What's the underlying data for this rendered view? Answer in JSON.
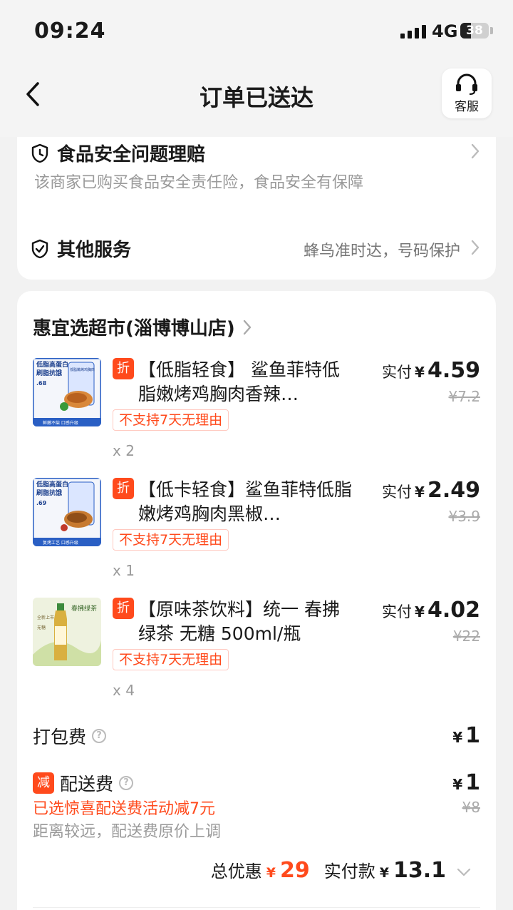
{
  "status_bar": {
    "time": "09:24",
    "network": "4G",
    "battery": "38",
    "battery_level": 0.38
  },
  "nav": {
    "title": "订单已送达",
    "service_label": "客服"
  },
  "services": {
    "food_safety": {
      "title": "食品安全问题理赔",
      "desc": "该商家已购买食品安全责任险，食品安全有保障"
    },
    "other": {
      "title": "其他服务",
      "value": "蜂鸟准时达，号码保护"
    }
  },
  "store": {
    "name": "惠宜选超市(淄博博山店)"
  },
  "items": [
    {
      "badge": "折",
      "name": "【低脂轻食】 鲨鱼菲特低脂嫩烤鸡胸肉香辣…",
      "tag": "不支持7天无理由",
      "qty": "x 2",
      "price_label": "实付",
      "currency": "¥",
      "price": "4.59",
      "orig_price": "¥7.2",
      "thumb": {
        "line1": "低脂高蛋白",
        "line2": "刷脂抗饿",
        "num": ".68",
        "pack": "低脂嫩烤鸡胸肉",
        "footer": "鲜嫩不柴 口感升级"
      }
    },
    {
      "badge": "折",
      "name": "【低卡轻食】鲨鱼菲特低脂嫩烤鸡胸肉黑椒…",
      "tag": "不支持7天无理由",
      "qty": "x 1",
      "price_label": "实付",
      "currency": "¥",
      "price": "2.49",
      "orig_price": "¥3.9",
      "thumb": {
        "line1": "低脂高蛋白",
        "line2": "刷脂抗饿",
        "num": ".69",
        "pack": "",
        "footer": "复烤工艺 口感升级"
      }
    },
    {
      "badge": "折",
      "name": "【原味茶饮料】统一 春拂绿茶 无糖 500ml/瓶",
      "tag": "不支持7天无理由",
      "qty": "x 4",
      "price_label": "实付",
      "currency": "¥",
      "price": "4.02",
      "orig_price": "¥22",
      "thumb": {
        "label1": "春拂绿茶",
        "label2": "全新上市",
        "label3": "无糖"
      }
    }
  ],
  "fees": {
    "packing": {
      "label": "打包费",
      "currency": "¥",
      "amount": "1"
    },
    "delivery": {
      "badge": "减",
      "label": "配送费",
      "currency": "¥",
      "amount": "1",
      "orig": "¥8",
      "promo": "已选惊喜配送费活动减7元",
      "note": "距离较远，配送费原价上调"
    }
  },
  "summary": {
    "discount_label": "总优惠",
    "discount_currency": "¥",
    "discount": "29",
    "paid_label": "实付款",
    "paid_currency": "¥",
    "paid": "13.1"
  },
  "colors": {
    "accent": "#ff4a1c",
    "bg": "#f2f2f2",
    "card": "#ffffff",
    "muted": "#9a9a9a"
  }
}
